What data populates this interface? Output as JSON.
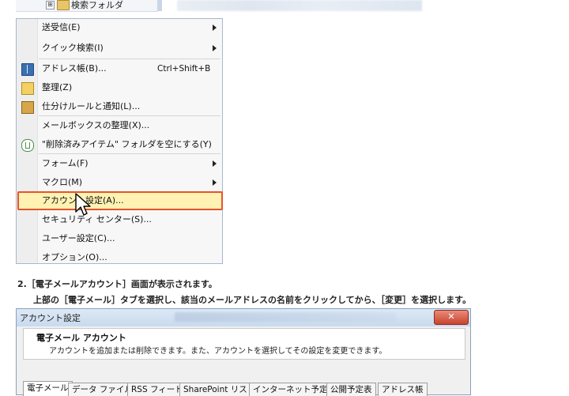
{
  "tree": {
    "toggle": "⊞",
    "folder_label": "検索フォルダ"
  },
  "menu": {
    "items": [
      {
        "label": "送受信(E)",
        "submenu": true
      },
      {
        "label": "クイック検索(I)",
        "submenu": true
      },
      {
        "label": "アドレス帳(B)...",
        "shortcut": "Ctrl+Shift+B",
        "icon": "address-book-icon"
      },
      {
        "label": "整理(Z)",
        "icon": "organize-icon"
      },
      {
        "label": "仕分けルールと通知(L)...",
        "icon": "rules-icon"
      },
      {
        "label": "メールボックスの整理(X)..."
      },
      {
        "label": "\"削除済みアイテム\" フォルダを空にする(Y)",
        "icon": "recycle-icon"
      },
      {
        "label": "フォーム(F)",
        "submenu": true
      },
      {
        "label": "マクロ(M)",
        "submenu": true
      },
      {
        "label": "アカウント設定(A)...",
        "highlighted": true
      },
      {
        "label": "セキュリティ センター(S)..."
      },
      {
        "label": "ユーザー設定(C)..."
      },
      {
        "label": "オプション(O)..."
      }
    ]
  },
  "instructions": {
    "step": "2.［電子メールアカウント］画面が表示されます。",
    "sub": "上部の［電子メール］タブを選択し、該当のメールアドレスの名前をクリックしてから、［変更］を選択します。"
  },
  "dialog": {
    "title": "アカウント設定",
    "close": "✕",
    "heading": "電子メール アカウント",
    "description": "アカウントを追加または削除できます。また、アカウントを選択してその設定を変更できます。",
    "tabs": [
      "電子メール",
      "データ ファイル",
      "RSS フィード",
      "SharePoint リスト",
      "インターネット予定表",
      "公開予定表",
      "アドレス帳"
    ],
    "active_tab": "電子メール"
  },
  "colors": {
    "highlight_border": "#e8542a",
    "highlight_fill": "#fff2b3",
    "menu_border": "#a7b7cf"
  }
}
